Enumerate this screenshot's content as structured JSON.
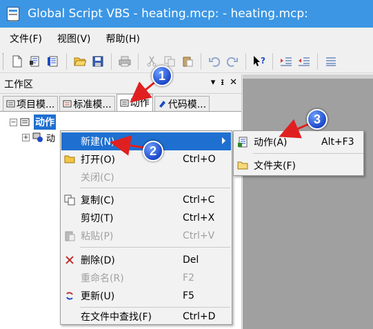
{
  "window": {
    "title": "Global Script VBS - heating.mcp: - heating.mcp:"
  },
  "menubar": [
    {
      "label": "文件(F)"
    },
    {
      "label": "视图(V)"
    },
    {
      "label": "帮助(H)"
    }
  ],
  "toolbar": {
    "icons": [
      "new-file-icon",
      "new-project-icon",
      "new-action-icon",
      "open-folder-icon",
      "save-icon",
      "print-icon",
      "cut-icon",
      "copy-icon",
      "paste-icon",
      "undo-icon",
      "redo-icon",
      "help-pointer-icon",
      "indent-icon",
      "outdent-icon",
      "format-icon"
    ]
  },
  "workspace": {
    "title": "工作区",
    "controls": {
      "dropdown": "▾",
      "pin": "ᵻ",
      "close": "✕"
    },
    "tabs": [
      {
        "label": "项目模..."
      },
      {
        "label": "标准模..."
      },
      {
        "label": "动作"
      },
      {
        "label": "代码模..."
      }
    ],
    "tree": {
      "root_label": "动作",
      "child_label": "动",
      "root_expander": "−",
      "child_expander": "+"
    }
  },
  "context_menu": {
    "items": [
      {
        "label": "新建(N)",
        "shortcut": ""
      },
      {
        "label": "打开(O)",
        "shortcut": "Ctrl+O"
      },
      {
        "label": "关闭(C)",
        "shortcut": ""
      },
      {
        "label": "复制(C)",
        "shortcut": "Ctrl+C"
      },
      {
        "label": "剪切(T)",
        "shortcut": "Ctrl+X"
      },
      {
        "label": "粘贴(P)",
        "shortcut": "Ctrl+V"
      },
      {
        "label": "删除(D)",
        "shortcut": "Del"
      },
      {
        "label": "重命名(R)",
        "shortcut": "F2"
      },
      {
        "label": "更新(U)",
        "shortcut": "F5"
      },
      {
        "label": "在文件中查找(F)",
        "shortcut": "Ctrl+D"
      }
    ]
  },
  "submenu": {
    "items": [
      {
        "label": "动作(A)",
        "shortcut": "Alt+F3"
      },
      {
        "label": "文件夹(F)",
        "shortcut": ""
      }
    ]
  },
  "callouts": [
    "1",
    "2",
    "3"
  ],
  "colors": {
    "titlebar": "#3c96e4",
    "highlight": "#1e6fd0",
    "callout": "#1d49c8",
    "arrow": "#e02020"
  }
}
